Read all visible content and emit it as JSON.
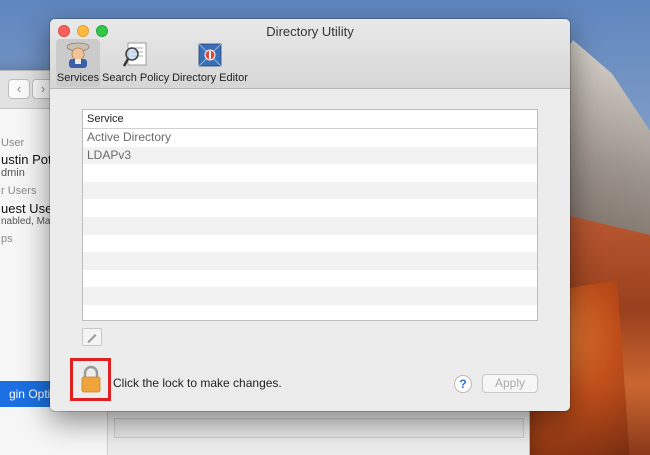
{
  "window": {
    "title": "Directory Utility"
  },
  "toolbar": {
    "tabs": [
      {
        "label": "Services",
        "icon": "services-icon",
        "active": true
      },
      {
        "label": "Search Policy",
        "icon": "search-policy-icon",
        "active": false
      },
      {
        "label": "Directory Editor",
        "icon": "directory-editor-icon",
        "active": false
      }
    ]
  },
  "services_table": {
    "header": "Service",
    "rows": [
      "Active Directory",
      "LDAPv3",
      "",
      "",
      "",
      "",
      "",
      "",
      "",
      "",
      ""
    ]
  },
  "footer": {
    "lock_text": "Click the lock to make changes.",
    "help_label": "?",
    "apply_label": "Apply"
  },
  "background_window": {
    "sidebar": {
      "current_user_header": "User",
      "current_user_name": "ustin Pot",
      "current_user_role": "dmin",
      "other_users_header": "r Users",
      "guest_user_name": "uest User",
      "guest_user_status": "nabled, Ma",
      "groups_header": "ps"
    },
    "login_options_label": "gin Optio"
  },
  "colors": {
    "highlight": "#e02020",
    "accent": "#1b6fe0"
  }
}
